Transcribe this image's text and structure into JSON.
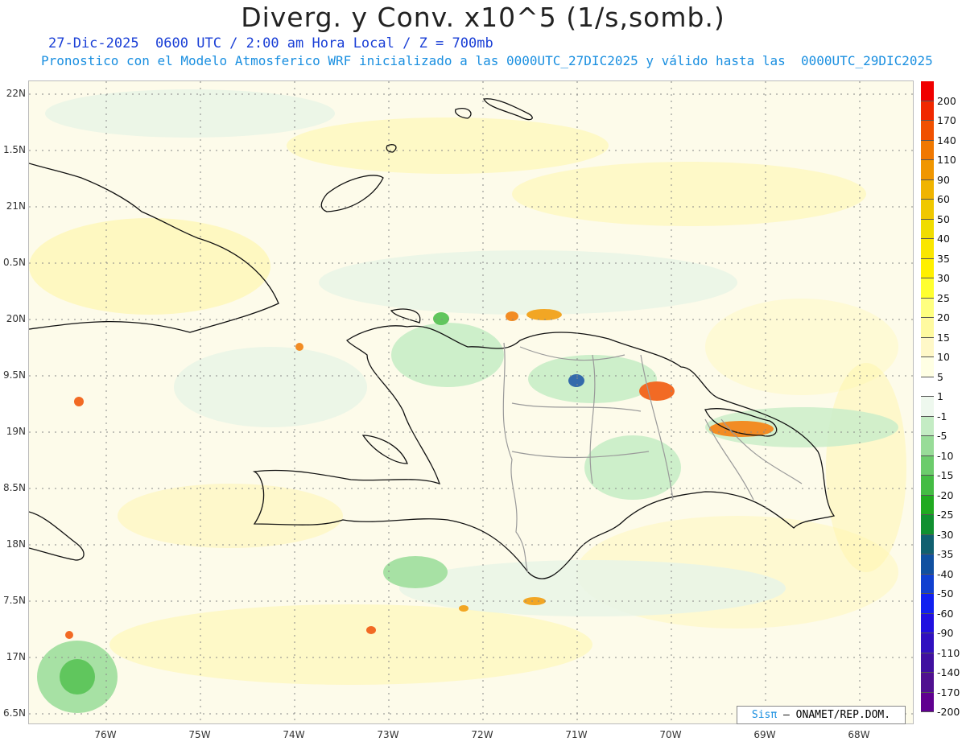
{
  "header": {
    "title": "Diverg. y Conv. x10^5 (1/s,somb.)",
    "subtitle_time": "27-Dic-2025  0600 UTC / 2:00 am Hora Local / Z = 700mb",
    "subtitle_model": "Pronostico con el Modelo Atmosferico WRF inicializado a las 0000UTC_27DIC2025 y válido hasta las  0000UTC_29DIC2025"
  },
  "axes": {
    "lat_labels": [
      "22N",
      "1.5N",
      "21N",
      "0.5N",
      "20N",
      "9.5N",
      "19N",
      "8.5N",
      "18N",
      "7.5N",
      "17N",
      "6.5N"
    ],
    "lon_labels": [
      "76W",
      "75W",
      "74W",
      "73W",
      "72W",
      "71W",
      "70W",
      "69W",
      "68W"
    ]
  },
  "colorbar": {
    "labels": [
      "200",
      "170",
      "140",
      "110",
      "90",
      "60",
      "50",
      "40",
      "35",
      "30",
      "25",
      "20",
      "15",
      "10",
      "5",
      "1",
      "-1",
      "-5",
      "-10",
      "-15",
      "-20",
      "-25",
      "-30",
      "-35",
      "-40",
      "-50",
      "-60",
      "-90",
      "-110",
      "-140",
      "-170",
      "-200"
    ],
    "colors": [
      "#f00000",
      "#f02800",
      "#f05000",
      "#f07800",
      "#f09600",
      "#f0b400",
      "#f0c800",
      "#f0dc00",
      "#fae600",
      "#fff000",
      "#ffff30",
      "#ffff80",
      "#fffaa0",
      "#fff8c8",
      "#ffffe4",
      "#ffffff",
      "#eef8ee",
      "#c4ecc4",
      "#98dc98",
      "#6ccc6c",
      "#44bc44",
      "#20aa20",
      "#109030",
      "#106070",
      "#1050a0",
      "#1040d0",
      "#1020f0",
      "#2010e0",
      "#3010c0",
      "#4010a0",
      "#501090",
      "#600090"
    ]
  },
  "credit": {
    "logo": "Sisπ",
    "text": "– ONAMET/REP.DOM."
  }
}
